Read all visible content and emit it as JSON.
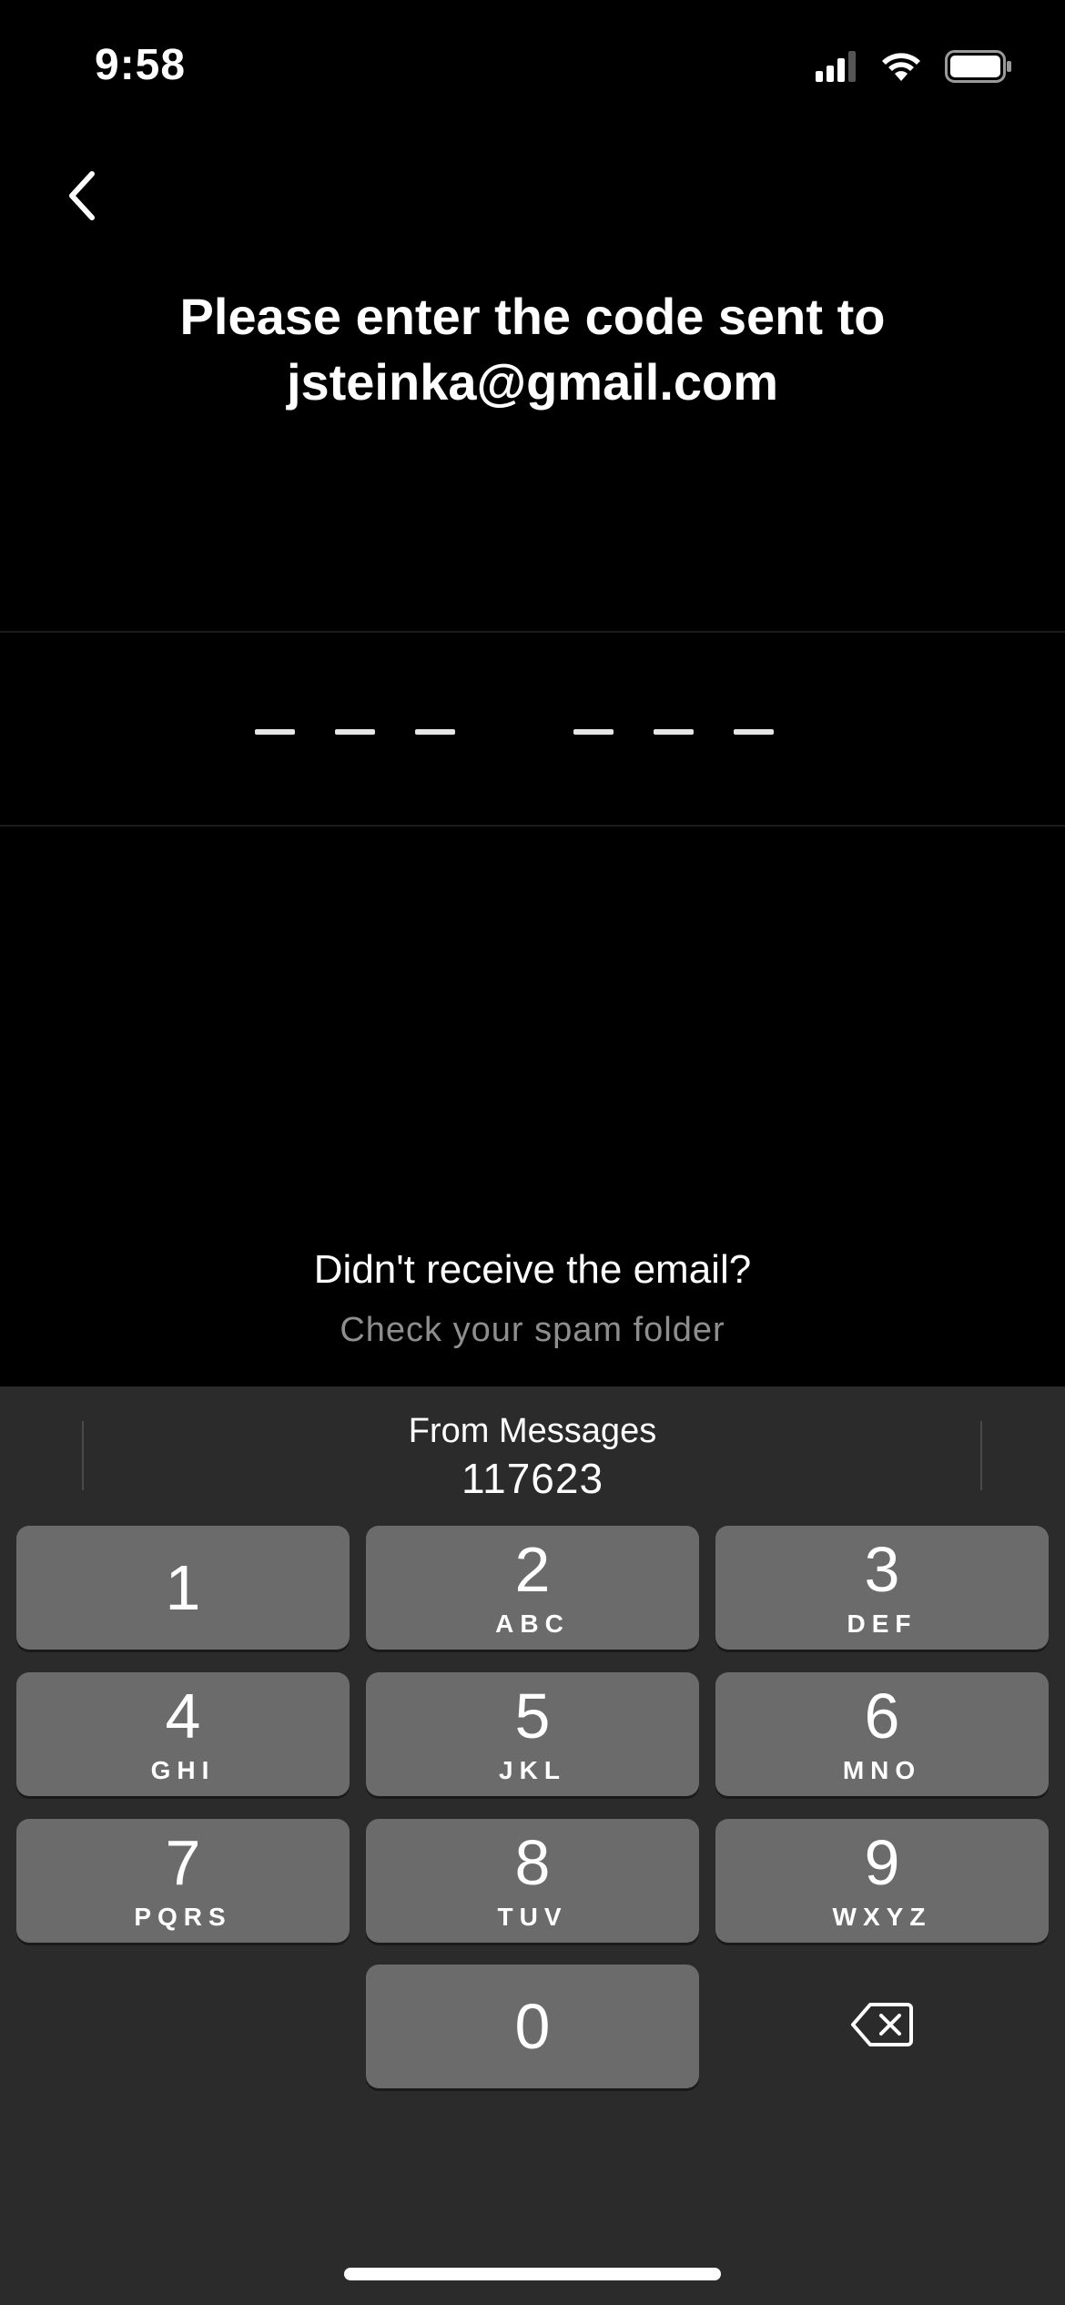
{
  "status_bar": {
    "time": "9:58",
    "icons": [
      "cellular-signal-icon",
      "wifi-icon",
      "battery-icon"
    ]
  },
  "header": {
    "back_icon": "chevron-left-icon",
    "title_line1": "Please enter the code sent to",
    "title_line2": "jsteinka@gmail.com"
  },
  "code_entry": {
    "digits_entered": 0,
    "slots": [
      "",
      "",
      "",
      "",
      "",
      ""
    ]
  },
  "help": {
    "question": "Didn't receive the email?",
    "hint": "Check your spam folder"
  },
  "keyboard": {
    "suggestion_source": "From Messages",
    "suggestion_code": "117623",
    "keys": [
      {
        "num": "1",
        "letters": ""
      },
      {
        "num": "2",
        "letters": "ABC"
      },
      {
        "num": "3",
        "letters": "DEF"
      },
      {
        "num": "4",
        "letters": "GHI"
      },
      {
        "num": "5",
        "letters": "JKL"
      },
      {
        "num": "6",
        "letters": "MNO"
      },
      {
        "num": "7",
        "letters": "PQRS"
      },
      {
        "num": "8",
        "letters": "TUV"
      },
      {
        "num": "9",
        "letters": "WXYZ"
      },
      {
        "num": "0",
        "letters": ""
      }
    ],
    "delete_icon": "backspace-icon"
  },
  "colors": {
    "background": "#000000",
    "keyboard_bg": "#2b2b2b",
    "key_bg": "#6b6b6b",
    "secondary_text": "#8e8e8e"
  }
}
